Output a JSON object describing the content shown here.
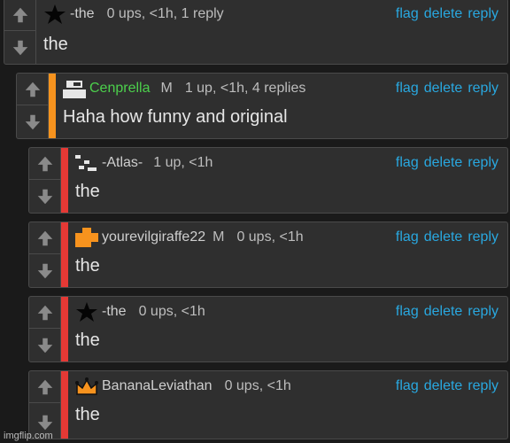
{
  "colors": {
    "link": "#29a8e0",
    "stripe_orange": "#f7931e",
    "stripe_red": "#e53935",
    "author_green": "#4cd04c"
  },
  "icons": {
    "upvote": "arrow-up-icon",
    "downvote": "arrow-down-icon"
  },
  "actions": {
    "flag": "flag",
    "delete": "delete",
    "reply": "reply"
  },
  "comments": [
    {
      "author": "-the",
      "avatar": "star-icon",
      "mod": "",
      "meta": "0 ups, <1h, 1 reply",
      "text": "the"
    },
    {
      "author": "Cenprella",
      "avatar": "pixel-avatar-icon",
      "mod": "M",
      "meta": "1 up, <1h, 4 replies",
      "text": "Haha how funny and original"
    },
    {
      "author": "-Atlas-",
      "avatar": "pixel-blocks-icon",
      "mod": "",
      "meta": "1 up, <1h",
      "text": "the"
    },
    {
      "author": "yourevilgiraffe22",
      "avatar": "orange-cross-icon",
      "mod": "M",
      "meta": "0 ups, <1h",
      "text": "the"
    },
    {
      "author": "-the",
      "avatar": "star-icon",
      "mod": "",
      "meta": "0 ups, <1h",
      "text": "the"
    },
    {
      "author": "BananaLeviathan",
      "avatar": "crown-icon",
      "mod": "",
      "meta": "0 ups, <1h",
      "text": "the"
    }
  ],
  "watermark": "imgflip.com"
}
